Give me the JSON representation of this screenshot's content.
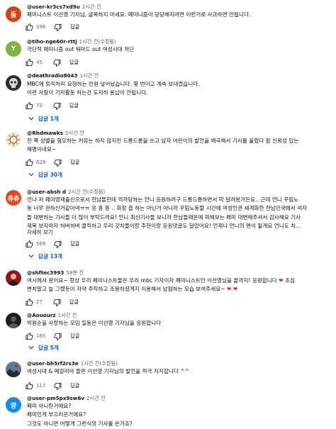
{
  "comments": [
    {
      "avatar_text": "듬",
      "avatar_color": "#d84315",
      "author": "@user-kr3cs7xd9u",
      "time": "2시간 전",
      "lines": [
        "페미니스트 이선영 기자님, 굴복하지 마세요. 페미니즘이 당당해지려면 이런거로 사과하면 안됩니다."
      ],
      "likes": "198",
      "reply_label": "답글"
    },
    {
      "avatar_text": "Y",
      "avatar_color": "#7cb342",
      "author": "@tiho-nge60r-rttj",
      "time": "1시간 전(수정됨)",
      "lines": [
        "극단적 페미니즘 out 워마드 out 여성시대 처단"
      ],
      "likes": "45",
      "reply_label": "답글"
    },
    {
      "avatar_text": "",
      "avatar_color": "#3a3a3a",
      "author": "@deathradio8043",
      "time": "1시간 전",
      "lines": [
        "MBC에 퇴직처리 요청하는 민원 넣어놨습니다. 몇 번이고 계속 보내겠습니다.",
        "이런 사람이 기자활동 하는건 도저히 용납이 안됩니다."
      ],
      "likes": "72",
      "reply_label": "답글",
      "replies_label": "답글 1개"
    },
    {
      "avatar_text": "",
      "avatar_color": "#e8e0cf",
      "author": "@Rhdmawks",
      "time": "2시간 전",
      "lines": [
        "한 쪽 성별을 혐오하는 커뮤는 하지 않지만 드릉드릉을 쓰고 남자 어린이의 발언을 왜곡해서 기사를 올렸다 참 신뢰성 있는",
        "해명이네요~"
      ],
      "likes": "629",
      "reply_label": "답글",
      "replies_label": "답글 30개"
    },
    {
      "avatar_text": "츄츄",
      "avatar_color": "#e64a19",
      "author": "@user-absh d",
      "time": "2시간 전(수정됨)",
      "lines": [
        "언냐 저 페미영재출신으로서 한남들한테 억까당하는 언니 응원하려구 드릉드릉하면서 막 달려왔거든요.. 근데 언니 꾸밈노",
        "동 너무 관하신거같아여ㅠㅠ 응 흥 흥 .. 화장 흠 하는 아닌거 아니까 꾸밈노동할 시간에 여성인권 세계화한 한남민국에서 여자",
        "들 대변하는 기사들 더 많이 부탁드려요! 언니 최신기사들 보니까 한남들때문에 피해보는 페미 대변해주셔서 감사해요 기사",
        "제목 보자마자 허버허버 클릭하고 우리 갓치들이랑 추천이랑 응원댓글도 달았어요! 언제나 언니의 편이 될게요 언니도 치..."
      ],
      "more_label": "자세히 보기",
      "likes": "569",
      "reply_label": "답글",
      "replies_label": "답글 13개"
    },
    {
      "avatar_text": "",
      "avatar_color": "#b71c1c",
      "author": "@shftec3993",
      "time": "58분 전",
      "lines": [
        "여시에서 왔어요~ 항상 우리 페미니스트들은 우리 mbc 기자이자 페미니스트인 이선영님을 끝까지! 응원합니다 ❤ 조심",
        "변치말고 늘 그랬듯이 자약 주작하고 조용하셨게지 이용해서 남혐하는 모습 보여주세요~ ❤ ❤"
      ],
      "likes": "27",
      "reply_label": "답글"
    },
    {
      "avatar_text": "",
      "avatar_color": "#212121",
      "author": "@Aouourz",
      "time": "1시간 전",
      "lines": [
        "박원순을 사랑하는 모임 일동은 이선영 기자님을 응원합니다"
      ],
      "likes": "165",
      "reply_label": "답글",
      "replies_label": "답글 5개"
    },
    {
      "avatar_text": "",
      "avatar_color": "#455a64",
      "author": "@user-bh5rf2rs3e",
      "time": "1시간 전(수정됨)",
      "lines": [
        "여성시대 & 메갈리아 들은 이선영 기자님의 발언을 적극 지지합니다 ^^"
      ],
      "likes": "117",
      "reply_label": "답글"
    },
    {
      "avatar_text": "양",
      "avatar_color": "#1e88e5",
      "author": "@user-pm5px9sw6v",
      "time": "2시간 전",
      "lines": [
        "페미 아니란거에요?",
        "페미인게 부끄러운거에요?",
        "그것도 아니면 어떻게 그런식의 기사를 쓴거죠?"
      ]
    }
  ]
}
